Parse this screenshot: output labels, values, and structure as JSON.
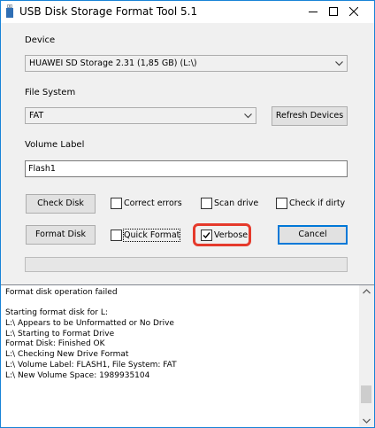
{
  "window": {
    "title": "USB Disk Storage Format Tool 5.1",
    "accent_color": "#1883d7",
    "title_icon": "usb-drive-icon",
    "controls": [
      "minimize-icon",
      "maximize-icon",
      "close-icon"
    ]
  },
  "device": {
    "label": "Device",
    "value": "HUAWEI  SD Storage  2.31 (1,85 GB) (L:\\)"
  },
  "file_system": {
    "label": "File System",
    "value": "FAT",
    "refresh_button": "Refresh Devices"
  },
  "volume": {
    "label": "Volume Label",
    "value": "Flash1"
  },
  "actions": {
    "check_disk": "Check Disk",
    "format_disk": "Format Disk",
    "cancel": "Cancel"
  },
  "options": {
    "correct_errors": {
      "label": "Correct errors",
      "checked": false
    },
    "scan_drive": {
      "label": "Scan drive",
      "checked": false
    },
    "check_if_dirty": {
      "label": "Check if dirty",
      "checked": false
    },
    "quick_format": {
      "label": "Quick Format",
      "checked": false
    },
    "verbose": {
      "label": "Verbose",
      "checked": true
    }
  },
  "highlight_color": "#e53a2c",
  "progress": {
    "value": 0
  },
  "log": {
    "lines": [
      "Format disk operation failed",
      "",
      "Starting format disk for L:",
      "L:\\ Appears to be Unformatted or No Drive",
      "L:\\ Starting to Format Drive",
      "Format Disk: Finished OK",
      "L:\\ Checking New Drive Format",
      "L:\\ Volume Label: FLASH1, File System: FAT",
      "L:\\ New Volume Space: 1989935104"
    ]
  }
}
